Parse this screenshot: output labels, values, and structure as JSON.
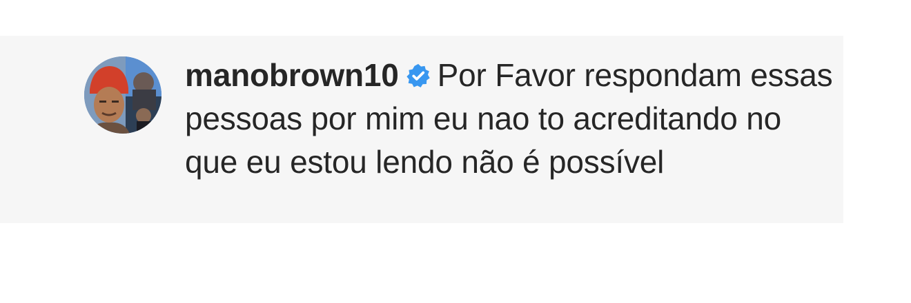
{
  "comment": {
    "username": "manobrown10",
    "verified_icon": "verified-badge-icon",
    "text": "Por Favor respondam essas pessoas por mim eu nao to acreditando no que eu estou lendo não é possível"
  },
  "colors": {
    "panel_background": "#f6f6f6",
    "text": "#262626",
    "verified_badge": "#3897f0"
  }
}
